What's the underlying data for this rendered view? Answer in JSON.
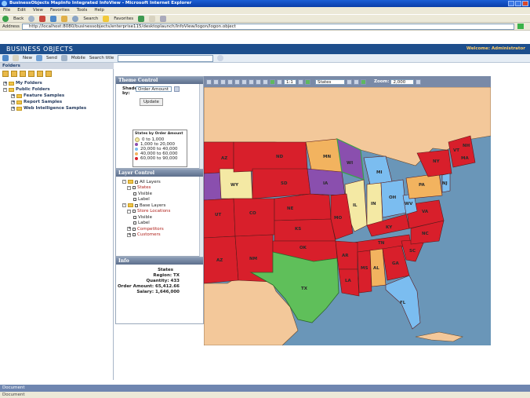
{
  "window": {
    "title": "BusinessObjects MapInfo Integrated InfoView - Microsoft Internet Explorer"
  },
  "menu": [
    "File",
    "Edit",
    "View",
    "Favorites",
    "Tools",
    "Help"
  ],
  "toolbar": {
    "back": "Back",
    "search": "Search",
    "favorites": "Favorites"
  },
  "address": {
    "label": "Address",
    "url": "http://localhost:8080/businessobjects/enterprise115/desktoplaunch/InfoView/logon/logon.object"
  },
  "bo_header": {
    "logo": "BUSINESS OBJECTS",
    "welcome": "Welcome: Administrator"
  },
  "bo_toolbar": {
    "new": "New",
    "send": "Send",
    "mobile": "Mobile",
    "search_label": "Search title"
  },
  "left_panel": {
    "header": "Folders",
    "items": [
      {
        "label": "My Folders",
        "level": 0
      },
      {
        "label": "Public Folders",
        "level": 0
      },
      {
        "label": "Feature Samples",
        "level": 1
      },
      {
        "label": "Report Samples",
        "level": 1
      },
      {
        "label": "Web Intelligence Samples",
        "level": 1
      }
    ]
  },
  "theme_control": {
    "title": "Theme Control",
    "theme_by_label": "Shade by:",
    "theme_by_value": "Order Amount",
    "update_label": "Update",
    "legend_title": "States by Order Amount",
    "legend_items": [
      {
        "label": "0 to 1,000",
        "color": "#f4e9a4"
      },
      {
        "label": "1,000 to 20,000",
        "color": "#8a4fae"
      },
      {
        "label": "20,000 to 40,000",
        "color": "#7bbdf0"
      },
      {
        "label": "40,000 to 60,000",
        "color": "#f2b35f"
      },
      {
        "label": "60,000 to 90,000",
        "color": "#d81f2b"
      }
    ]
  },
  "layer_control": {
    "title": "Layer Control",
    "items": [
      {
        "label": "All Layers",
        "level": 0
      },
      {
        "label": "States",
        "level": 1
      },
      {
        "label": "Visible",
        "level": 2
      },
      {
        "label": "Label",
        "level": 2
      },
      {
        "label": "Base Layers",
        "level": 0
      },
      {
        "label": "Store Locations",
        "level": 1
      },
      {
        "label": "Visible",
        "level": 2
      },
      {
        "label": "Label",
        "level": 2
      },
      {
        "label": "Competitors",
        "level": 1
      },
      {
        "label": "Customers",
        "level": 1
      }
    ]
  },
  "info_panel": {
    "title": "Info",
    "heading": "States",
    "rows": [
      {
        "label": "Region:",
        "value": "TX"
      },
      {
        "label": "Quantity:",
        "value": "433"
      },
      {
        "label": "Order Amount:",
        "value": "65,412.66"
      },
      {
        "label": "Salary:",
        "value": "1,646,000"
      }
    ]
  },
  "map_toolbar": {
    "layer_select": "States",
    "zoom_label": "Zoom:",
    "zoom_value": "2,000",
    "scale_value": "1:1"
  },
  "map": {
    "colors": {
      "ocean": "#6a96b8",
      "land_other": "#f3c89a",
      "level_0": "#f4e9a4",
      "level_1": "#8a4fae",
      "level_2": "#7bbdf0",
      "level_3": "#f2b35f",
      "level_4": "#d81f2b",
      "selected": "#5fbf5a",
      "border": "#5b1a1a"
    },
    "state_labels": [
      "ND",
      "MN",
      "WI",
      "SD",
      "MI",
      "NE",
      "IA",
      "IL",
      "IN",
      "OH",
      "PA",
      "NY",
      "CO",
      "KS",
      "MO",
      "KY",
      "WV",
      "VA",
      "NC",
      "TN",
      "SC",
      "GA",
      "AL",
      "MS",
      "AR",
      "OK",
      "NM",
      "AZ",
      "TX",
      "LA",
      "FL",
      "NV",
      "UT",
      "WY",
      "NJ",
      "VT",
      "NH",
      "MA"
    ]
  },
  "status": {
    "text": "Document"
  }
}
